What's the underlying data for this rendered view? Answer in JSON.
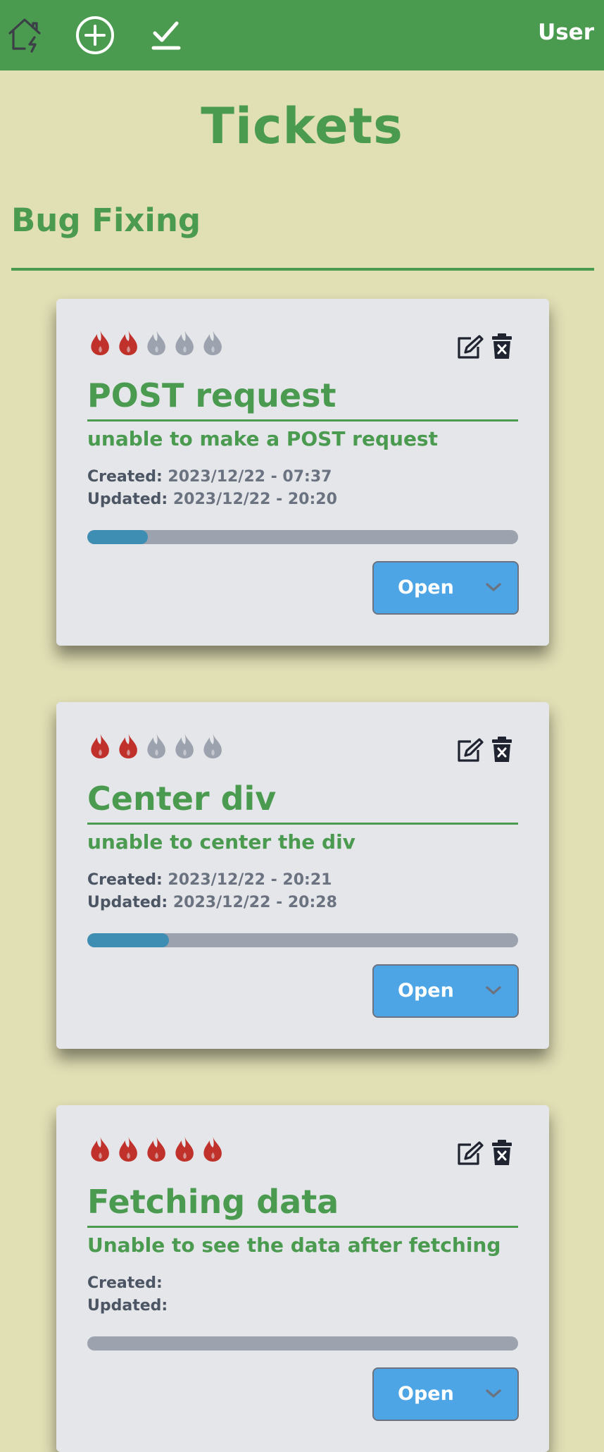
{
  "navbar": {
    "icons": [
      "home-bolt-icon",
      "add-circle-icon",
      "check-icon"
    ],
    "user_label": "User",
    "bg_color": "#4a9a4f"
  },
  "page": {
    "title": "Tickets"
  },
  "section": {
    "title": "Bug Fixing"
  },
  "colors": {
    "accent": "#4a9a4f",
    "flame_active": "#c0312b",
    "flame_inactive": "#9ca3af",
    "status_button": "#4da5e5",
    "progress": "#3e8db3"
  },
  "tickets": [
    {
      "priority": 2,
      "priority_max": 5,
      "title": "POST request",
      "description": "unable to make a POST request",
      "created_label": "Created:",
      "created": "2023/12/22 - 07:37",
      "updated_label": "Updated:",
      "updated": "2023/12/22 - 20:20",
      "progress": 0.14,
      "status": "Open"
    },
    {
      "priority": 2,
      "priority_max": 5,
      "title": "Center div",
      "description": "unable to center the div",
      "created_label": "Created:",
      "created": "2023/12/22 - 20:21",
      "updated_label": "Updated:",
      "updated": "2023/12/22 - 20:28",
      "progress": 0.19,
      "status": "Open"
    },
    {
      "priority": 5,
      "priority_max": 5,
      "title": "Fetching data",
      "description": "Unable to see the data after fetching",
      "created_label": "Created:",
      "created": "",
      "updated_label": "Updated:",
      "updated": "",
      "progress": 0,
      "status": "Open"
    }
  ]
}
